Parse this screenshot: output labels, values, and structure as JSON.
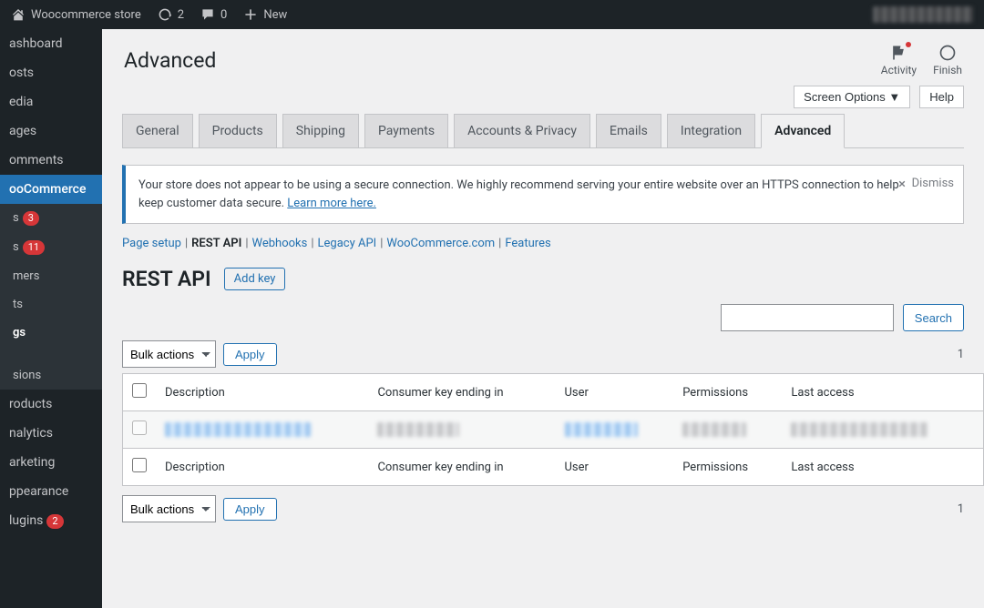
{
  "adminbar": {
    "site_name": "Woocommerce store",
    "updates": "2",
    "comments": "0",
    "new_label": "New"
  },
  "sidebar": {
    "items": [
      {
        "label": "ashboard"
      },
      {
        "label": "osts"
      },
      {
        "label": "edia"
      },
      {
        "label": "ages"
      },
      {
        "label": "omments"
      },
      {
        "label": "ooCommerce",
        "current": true
      },
      {
        "label": "s",
        "sub": true,
        "badge": "3"
      },
      {
        "label": "s",
        "sub": true,
        "badge": "11"
      },
      {
        "label": "mers",
        "sub": true
      },
      {
        "label": "ts",
        "sub": true
      },
      {
        "label": "gs",
        "sub": true,
        "active": true
      },
      {
        "label": "",
        "sub": true
      },
      {
        "label": "sions",
        "sub": true
      },
      {
        "label": "roducts"
      },
      {
        "label": "nalytics"
      },
      {
        "label": "arketing"
      },
      {
        "label": "ppearance"
      },
      {
        "label": "lugins",
        "badge": "2"
      }
    ]
  },
  "header": {
    "title": "Advanced",
    "activity": "Activity",
    "finish": "Finish"
  },
  "top_options": {
    "screen": "Screen Options ▼",
    "help": "Help"
  },
  "tabs": [
    {
      "label": "General"
    },
    {
      "label": "Products"
    },
    {
      "label": "Shipping"
    },
    {
      "label": "Payments"
    },
    {
      "label": "Accounts & Privacy"
    },
    {
      "label": "Emails"
    },
    {
      "label": "Integration"
    },
    {
      "label": "Advanced",
      "active": true
    }
  ],
  "notice": {
    "text": "Your store does not appear to be using a secure connection. We highly recommend serving your entire website over an HTTPS connection to help keep customer data secure. ",
    "link": "Learn more here.",
    "dismiss": "Dismiss"
  },
  "subsub": [
    {
      "label": "Page setup",
      "link": true
    },
    {
      "label": "REST API",
      "current": true
    },
    {
      "label": "Webhooks",
      "link": true
    },
    {
      "label": "Legacy API",
      "link": true
    },
    {
      "label": "WooCommerce.com",
      "link": true
    },
    {
      "label": "Features",
      "link": true
    }
  ],
  "pagehead": {
    "title": "REST API",
    "button": "Add key"
  },
  "search": {
    "button": "Search"
  },
  "bulk": {
    "select": "Bulk actions",
    "apply": "Apply",
    "count": "1"
  },
  "columns": {
    "desc": "Description",
    "ckey": "Consumer key ending in",
    "user": "User",
    "perm": "Permissions",
    "last": "Last access"
  }
}
